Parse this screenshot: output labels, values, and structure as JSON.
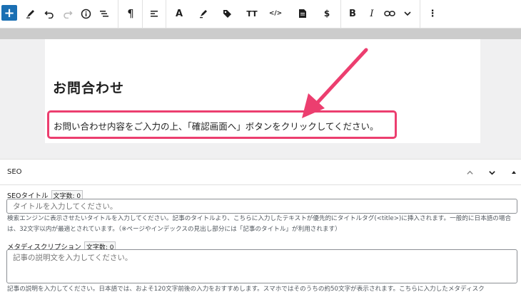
{
  "toolbar": {
    "add_block": "+",
    "tools_icon": "pen-icon",
    "undo_icon": "undo-icon",
    "redo_icon": "redo-icon",
    "info_icon": "info-icon",
    "list_view_icon": "list-view-icon",
    "paragraph_icon": "¶",
    "align_icon": "align-icon",
    "font_icon": "A",
    "highlighter_icon": "highlighter-icon",
    "tag_icon": "tag-icon",
    "font_size_icon": "TT",
    "code_icon": "</>",
    "document_icon": "document-icon",
    "dollar_icon": "$",
    "bold_label": "B",
    "italic_label": "I",
    "link_icon": "link-icon",
    "more_icon": "chevron-down-icon",
    "options_icon": "⋮"
  },
  "editor": {
    "heading": "お問合わせ",
    "paragraph": "お問い合わせ内容をご入力の上、「確認画面へ」ボタンをクリックしてください。",
    "highlight_color": "#ec3e6f",
    "arrow_color": "#ec3e6f"
  },
  "seo": {
    "panel_title": "SEO",
    "title_field": {
      "label": "SEOタイトル",
      "count": "文字数: 0",
      "placeholder": "タイトルを入力してください。",
      "help": "検索エンジンに表示させたいタイトルを入力してください。記事のタイトルより、こちらに入力したテキストが優先的にタイトルタグ(<title>)に挿入されます。一般的に日本語の場合は、32文字以内が最適とされています。（※ページやインデックスの見出し部分には「記事のタイトル」が利用されます）"
    },
    "description_field": {
      "label": "メタディスクリプション",
      "count": "文字数: 0",
      "placeholder": "記事の説明文を入力してください。",
      "help": "記事の説明を入力してください。日本語では、およそ120文字前後の入力をおすすめします。スマホではそのうちの約50文字が表示されます。こちらに入力したメタディスク"
    }
  }
}
